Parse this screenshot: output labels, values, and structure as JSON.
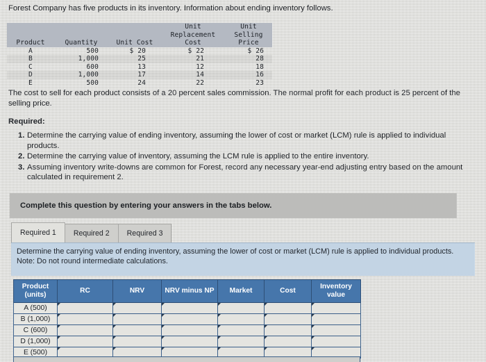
{
  "intro": {
    "text": "Forest Company has five products in its inventory. Information about ending inventory follows."
  },
  "fact_table": {
    "headers": {
      "product": "Product",
      "quantity": "Quantity",
      "unit_cost": "Unit Cost",
      "unit_replacement_cost_line1": "Unit Replacement",
      "unit_replacement_cost_line2": "Cost",
      "unit_selling_price_line1": "Unit Selling",
      "unit_selling_price_line2": "Price"
    },
    "rows": [
      {
        "product": "A",
        "quantity": "500",
        "unit_cost": "$ 20",
        "replacement_cost": "$ 22",
        "selling_price": "$ 26"
      },
      {
        "product": "B",
        "quantity": "1,000",
        "unit_cost": "25",
        "replacement_cost": "21",
        "selling_price": "28"
      },
      {
        "product": "C",
        "quantity": "600",
        "unit_cost": "13",
        "replacement_cost": "12",
        "selling_price": "18"
      },
      {
        "product": "D",
        "quantity": "1,000",
        "unit_cost": "17",
        "replacement_cost": "14",
        "selling_price": "16"
      },
      {
        "product": "E",
        "quantity": "500",
        "unit_cost": "24",
        "replacement_cost": "22",
        "selling_price": "23"
      }
    ]
  },
  "cost_note": {
    "text": "The cost to sell for each product consists of a 20 percent sales commission. The normal profit for each product is 25 percent of the selling price."
  },
  "required": {
    "label": "Required:",
    "items": [
      {
        "num": "1.",
        "text": "Determine the carrying value of ending inventory, assuming the lower of cost or market (LCM) rule is applied to individual products."
      },
      {
        "num": "2.",
        "text": "Determine the carrying value of inventory, assuming the LCM rule is applied to the entire inventory."
      },
      {
        "num": "3.",
        "text": "Assuming inventory write-downs are common for Forest, record any necessary year-end adjusting entry based on the amount calculated in requirement 2."
      }
    ]
  },
  "banner": {
    "text": "Complete this question by entering your answers in the tabs below."
  },
  "tabs": {
    "items": [
      {
        "label": "Required 1",
        "active": true
      },
      {
        "label": "Required 2",
        "active": false
      },
      {
        "label": "Required 3",
        "active": false
      }
    ]
  },
  "instruction_panel": {
    "line1": "Determine the carrying value of ending inventory, assuming the lower of cost or market (LCM) rule is applied to individual products.",
    "line2": "Note: Do not round intermediate calculations."
  },
  "answer_grid": {
    "headers": {
      "product_line1": "Product",
      "product_line2": "(units)",
      "rc": "RC",
      "nrv": "NRV",
      "nrv_minus_np": "NRV minus NP",
      "market": "Market",
      "cost": "Cost",
      "inventory_value_line1": "Inventory",
      "inventory_value_line2": "value"
    },
    "rows": [
      {
        "label": "A (500)",
        "rc": "",
        "nrv": "",
        "nrv_minus_np": "",
        "market": "",
        "cost": "",
        "inventory_value": ""
      },
      {
        "label": "B (1,000)",
        "rc": "",
        "nrv": "",
        "nrv_minus_np": "",
        "market": "",
        "cost": "",
        "inventory_value": ""
      },
      {
        "label": "C (600)",
        "rc": "",
        "nrv": "",
        "nrv_minus_np": "",
        "market": "",
        "cost": "",
        "inventory_value": ""
      },
      {
        "label": "D (1,000)",
        "rc": "",
        "nrv": "",
        "nrv_minus_np": "",
        "market": "",
        "cost": "",
        "inventory_value": ""
      },
      {
        "label": "E (500)",
        "rc": "",
        "nrv": "",
        "nrv_minus_np": "",
        "market": "",
        "cost": "",
        "inventory_value": ""
      }
    ]
  },
  "colors": {
    "page_background": "#d9d9d5",
    "fact_header": "#b4b9c2",
    "banner": "#bcbcba",
    "grid_header": "#4676ab",
    "instruction_panel": "#c3d4e4",
    "tab_active": "#e2e2de",
    "tab_inactive": "#cfcfcc"
  }
}
